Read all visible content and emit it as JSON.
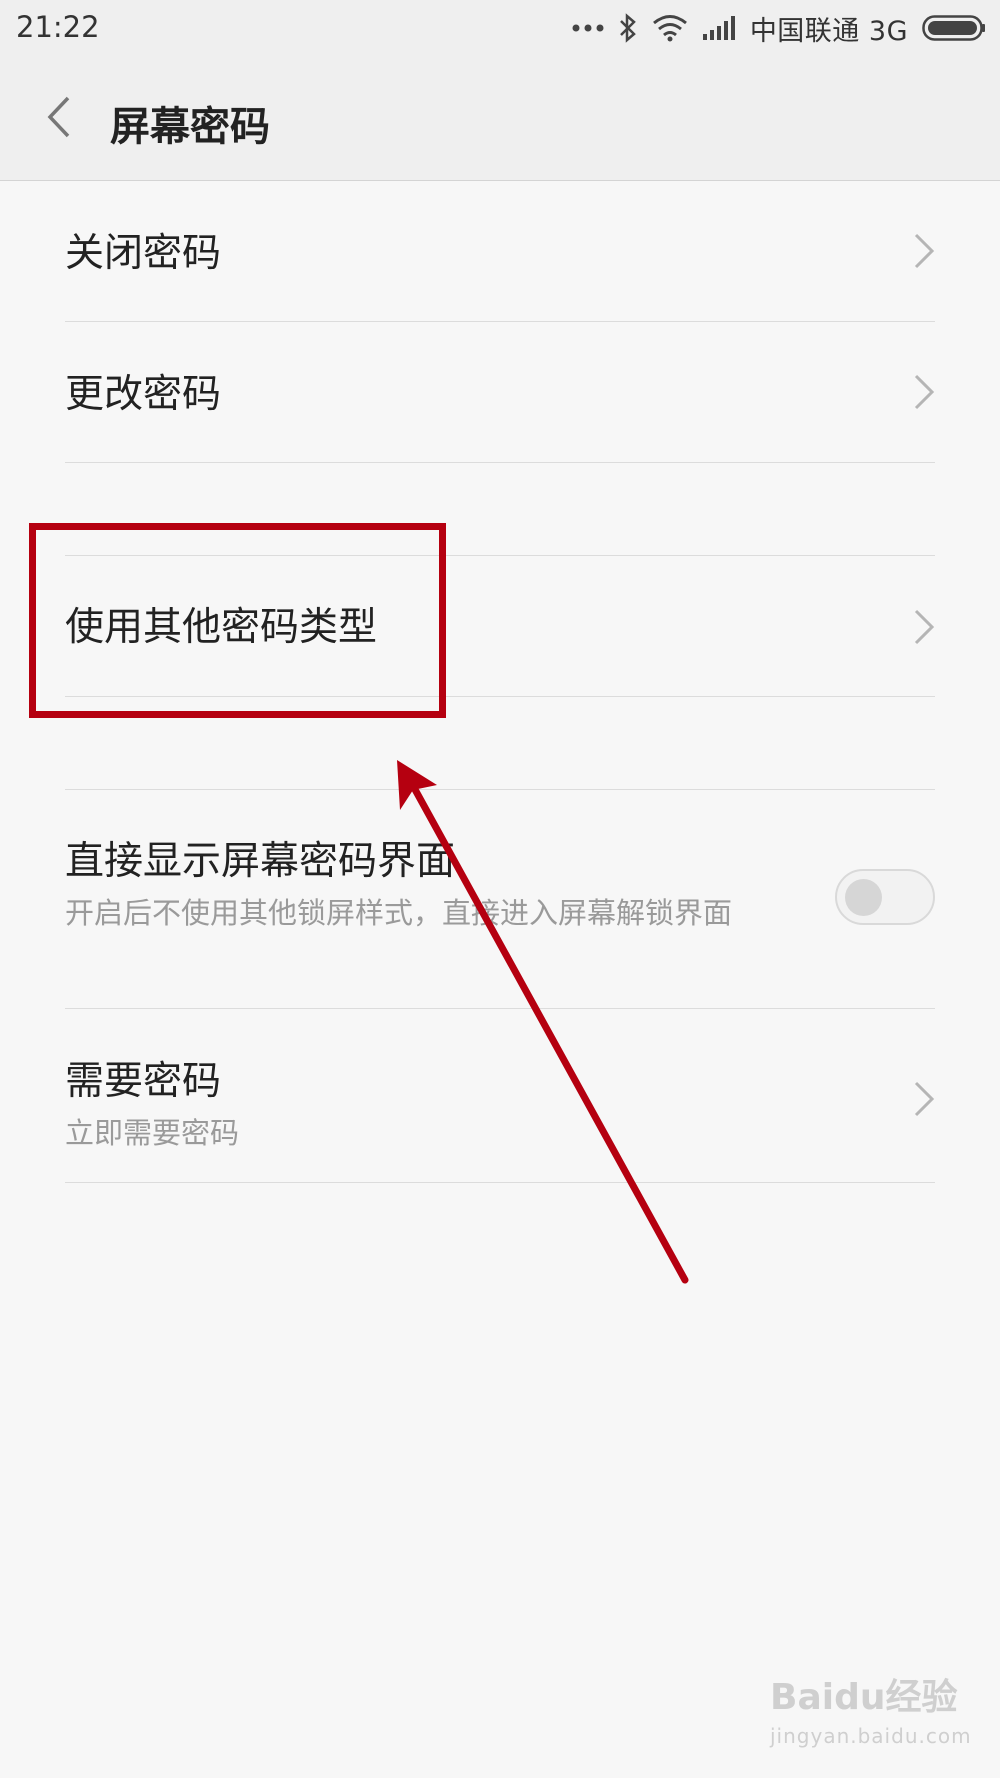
{
  "status_bar": {
    "time": "21:22",
    "carrier": "中国联通 3G",
    "icons": [
      "more-dots-icon",
      "bluetooth-icon",
      "wifi-icon",
      "signal-icon",
      "battery-icon"
    ]
  },
  "header": {
    "title": "屏幕密码",
    "back_icon": "chevron-left-icon"
  },
  "settings": {
    "close_password": {
      "title": "关闭密码"
    },
    "change_password": {
      "title": "更改密码"
    },
    "other_password_type": {
      "title": "使用其他密码类型"
    },
    "show_password_screen": {
      "title": "直接显示屏幕密码界面",
      "subtitle": "开启后不使用其他锁屏样式，直接进入屏幕解锁界面",
      "enabled": false
    },
    "require_password": {
      "title": "需要密码",
      "subtitle": "立即需要密码"
    }
  },
  "annotation": {
    "color": "#b50010"
  },
  "watermark": {
    "brand": "Baidu经验",
    "url": "jingyan.baidu.com"
  }
}
